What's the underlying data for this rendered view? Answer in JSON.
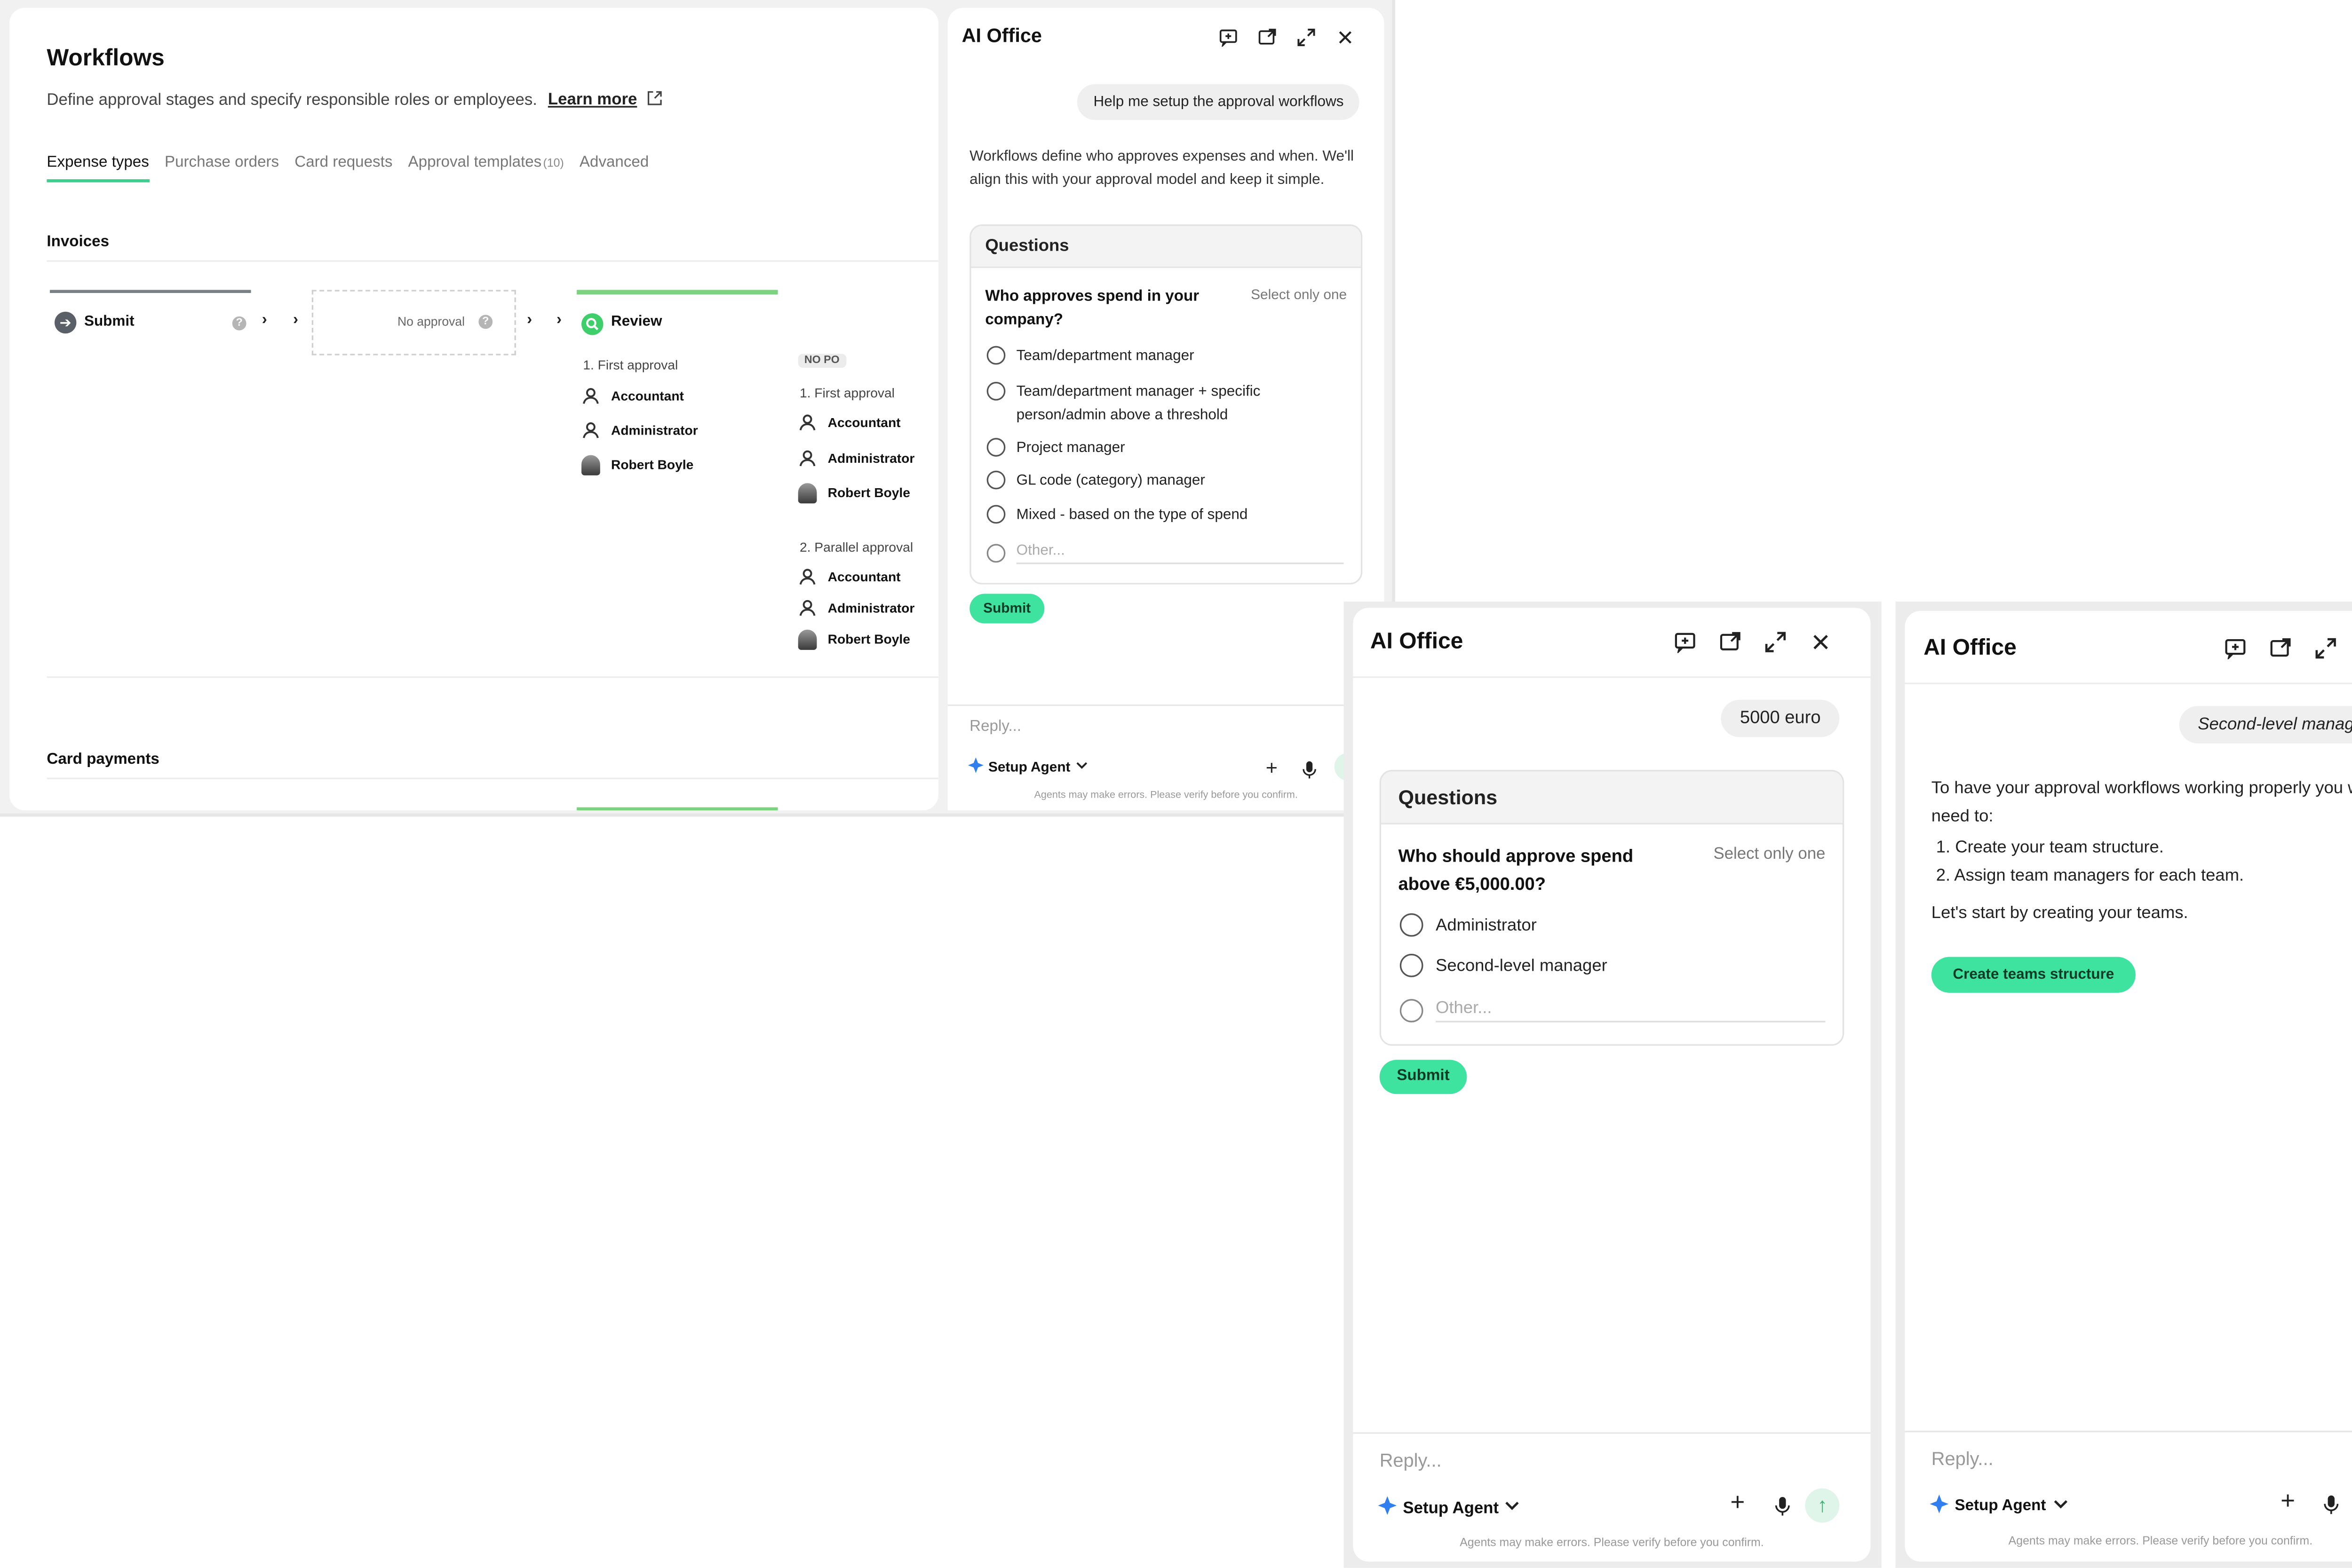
{
  "workflows": {
    "title": "Workflows",
    "subtitle": "Define approval stages and specify responsible roles or employees.",
    "learn_more": "Learn more",
    "tabs": [
      {
        "label": "Expense types",
        "count": ""
      },
      {
        "label": "Purchase orders",
        "count": ""
      },
      {
        "label": "Card requests",
        "count": ""
      },
      {
        "label": "Approval templates",
        "count": "(10)"
      },
      {
        "label": "Advanced",
        "count": ""
      }
    ],
    "invoices": {
      "title": "Invoices",
      "submit": "Submit",
      "no_approval": "No approval",
      "review": "Review",
      "first_approval": "1. First approval",
      "no_po": "NO PO",
      "first_approval_2": "1. First approval",
      "parallel_approval": "2. Parallel approval",
      "approvers": [
        "Accountant",
        "Administrator",
        "Robert Boyle"
      ]
    },
    "card_payments": "Card payments"
  },
  "chat1": {
    "title": "AI Office",
    "user_message": "Help me setup the approval workflows",
    "assistant_text": "Workflows define who approves expenses and when. We'll align this with your approval model and keep it simple.",
    "questions_header": "Questions",
    "question": "Who approves spend in your company?",
    "select_hint": "Select only one",
    "options": [
      "Team/department manager",
      "Team/department manager + specific person/admin above a threshold",
      "Project manager",
      "GL code (category) manager",
      "Mixed - based on the type of spend"
    ],
    "other_placeholder": "Other...",
    "submit": "Submit",
    "reply_placeholder": "Reply...",
    "agent": "Setup Agent",
    "disclaimer": "Agents may make errors. Please verify before you confirm."
  },
  "chat2": {
    "title": "AI Office",
    "user_message": "5000 euro",
    "questions_header": "Questions",
    "question": "Who should approve spend above €5,000.00?",
    "select_hint": "Select only one",
    "options": [
      "Administrator",
      "Second-level manager"
    ],
    "other_placeholder": "Other...",
    "submit": "Submit",
    "reply_placeholder": "Reply...",
    "agent": "Setup Agent",
    "disclaimer": "Agents may make errors. Please verify before you confirm."
  },
  "chat3": {
    "title": "AI Office",
    "user_message": "Second-level manager",
    "intro": "To have your approval workflows working properly you will need to:",
    "steps": [
      "1. Create your team structure.",
      "2. Assign team managers for each team."
    ],
    "outro": "Let's start by creating your teams.",
    "cta": "Create teams structure",
    "reply_placeholder": "Reply...",
    "agent": "Setup Agent",
    "disclaimer": "Agents may make errors. Please verify before you confirm."
  },
  "colors": {
    "accent_green": "#3fe3a0",
    "tab_underline": "#3ecf8e",
    "review_bar": "#7bd27f",
    "agent_icon": "#2f7ff0"
  }
}
